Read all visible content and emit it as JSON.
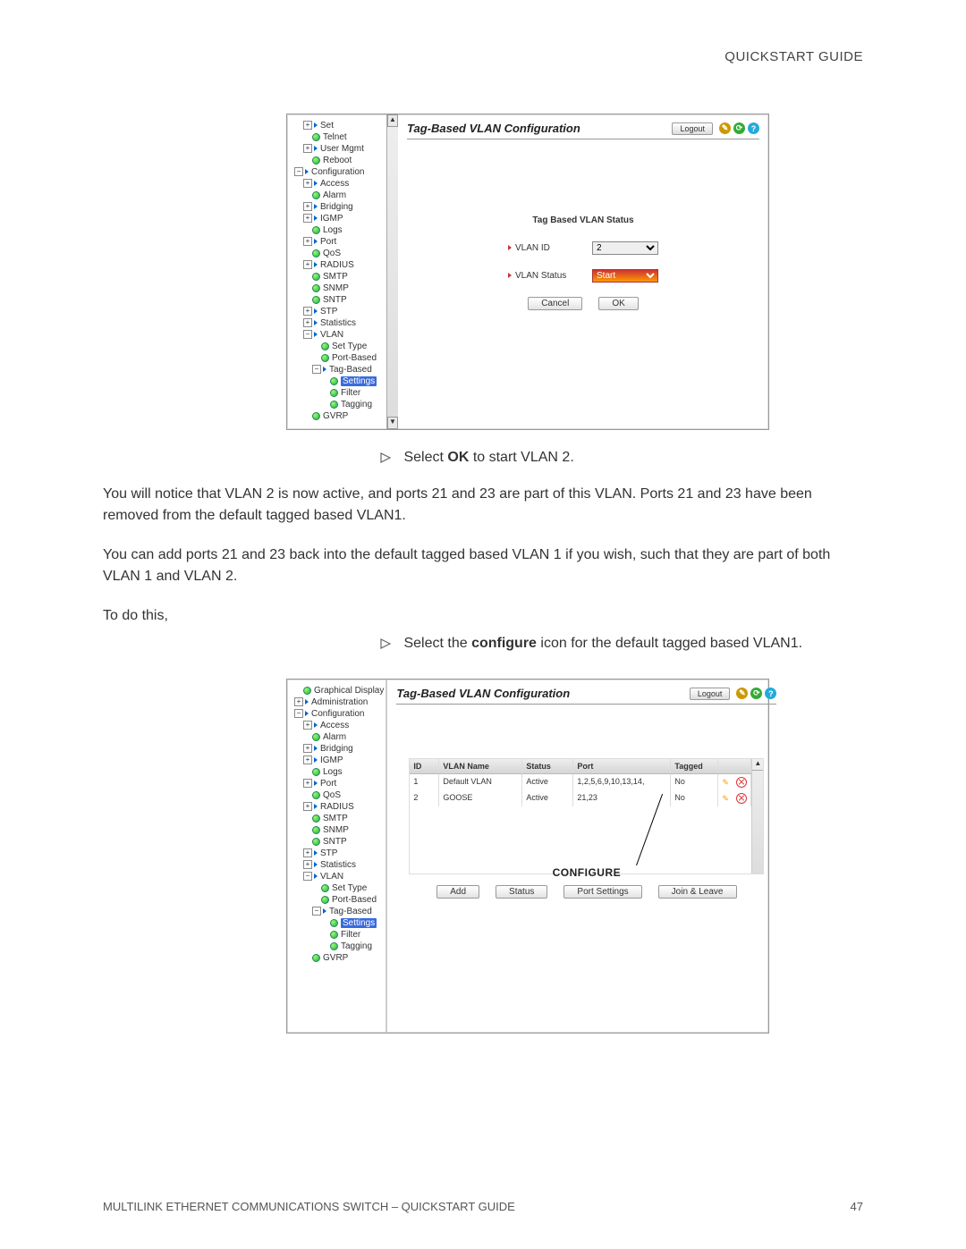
{
  "header": {
    "title": "QUICKSTART GUIDE"
  },
  "screenshot1": {
    "title": "Tag-Based VLAN Configuration",
    "logout": "Logout",
    "status_title": "Tag Based VLAN Status",
    "field_vlan_id": "VLAN ID",
    "value_vlan_id": "2",
    "field_vlan_status": "VLAN Status",
    "value_vlan_status": "Start",
    "btn_cancel": "Cancel",
    "btn_ok": "OK",
    "tree": [
      "Set",
      "Telnet",
      "User Mgmt",
      "Reboot",
      "Configuration",
      "Access",
      "Alarm",
      "Bridging",
      "IGMP",
      "Logs",
      "Port",
      "QoS",
      "RADIUS",
      "SMTP",
      "SNMP",
      "SNTP",
      "STP",
      "Statistics",
      "VLAN",
      "Set Type",
      "Port-Based",
      "Tag-Based",
      "Settings",
      "Filter",
      "Tagging",
      "GVRP"
    ]
  },
  "instruction1": {
    "text_a": "Select ",
    "bold": "OK",
    "text_b": " to start VLAN 2."
  },
  "para1": "You will notice that VLAN 2 is now active, and ports 21 and 23 are part of this VLAN. Ports 21 and 23 have been removed from the default tagged based VLAN1.",
  "para2": "You can add ports 21 and 23 back into the default tagged based VLAN 1 if you wish, such that they are part of both VLAN 1 and VLAN 2.",
  "para3": "To do this,",
  "instruction2": {
    "text_a": "Select the ",
    "bold": "configure",
    "text_b": " icon for the default tagged based VLAN1."
  },
  "screenshot2": {
    "title": "Tag-Based VLAN Configuration",
    "logout": "Logout",
    "configure_label": "CONFIGURE",
    "columns": {
      "id": "ID",
      "name": "VLAN Name",
      "status": "Status",
      "port": "Port",
      "tagged": "Tagged"
    },
    "rows": [
      {
        "id": "1",
        "name": "Default VLAN",
        "status": "Active",
        "port": "1,2,5,6,9,10,13,14,",
        "tagged": "No"
      },
      {
        "id": "2",
        "name": "GOOSE",
        "status": "Active",
        "port": "21,23",
        "tagged": "No"
      }
    ],
    "buttons": {
      "add": "Add",
      "status": "Status",
      "port_settings": "Port Settings",
      "join": "Join & Leave"
    },
    "tree": [
      "Graphical Display",
      "Administration",
      "Configuration",
      "Access",
      "Alarm",
      "Bridging",
      "IGMP",
      "Logs",
      "Port",
      "QoS",
      "RADIUS",
      "SMTP",
      "SNMP",
      "SNTP",
      "STP",
      "Statistics",
      "VLAN",
      "Set Type",
      "Port-Based",
      "Tag-Based",
      "Settings",
      "Filter",
      "Tagging",
      "GVRP"
    ]
  },
  "footer": {
    "left": "MULTILINK ETHERNET COMMUNICATIONS SWITCH – QUICKSTART GUIDE",
    "right": "47"
  }
}
